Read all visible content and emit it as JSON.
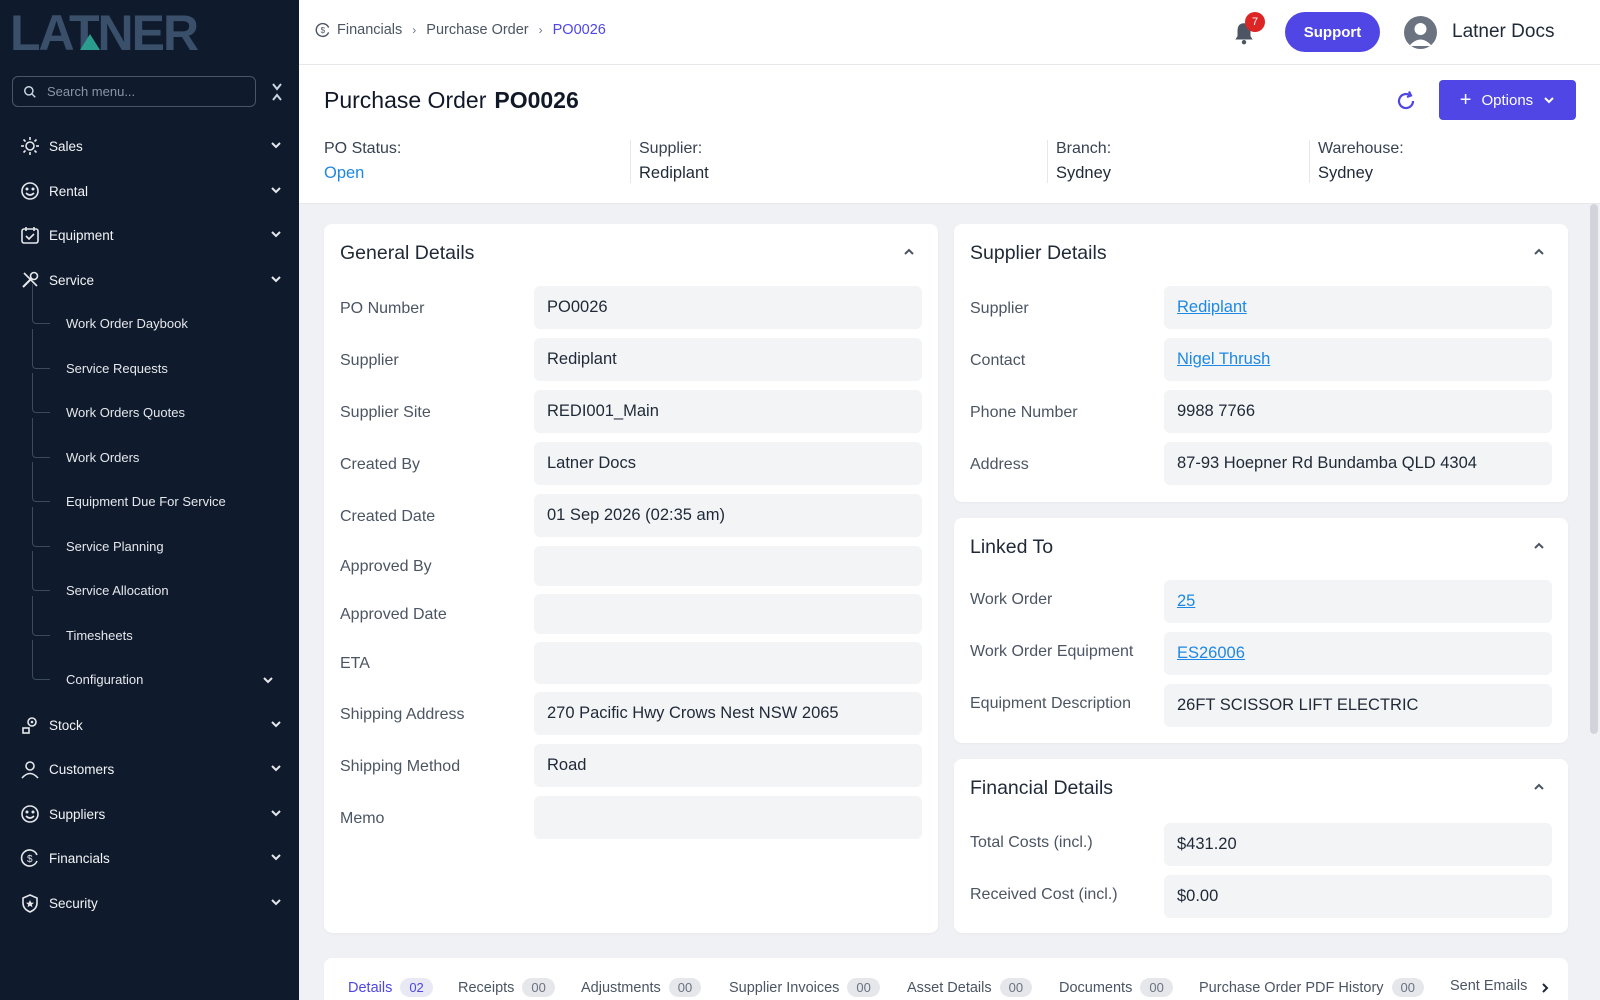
{
  "brand": {
    "logo_text": "LATNER"
  },
  "search": {
    "placeholder": "Search menu..."
  },
  "sidebar": {
    "items": [
      {
        "label": "Sales",
        "icon": "sales-icon"
      },
      {
        "label": "Rental",
        "icon": "rental-icon"
      },
      {
        "label": "Equipment",
        "icon": "equipment-icon"
      },
      {
        "label": "Service",
        "icon": "service-icon"
      },
      {
        "label": "Stock",
        "icon": "stock-icon"
      },
      {
        "label": "Customers",
        "icon": "customers-icon"
      },
      {
        "label": "Suppliers",
        "icon": "suppliers-icon"
      },
      {
        "label": "Financials",
        "icon": "financials-icon"
      },
      {
        "label": "Security",
        "icon": "security-icon"
      }
    ],
    "service_sub": [
      "Work Order Daybook",
      "Service Requests",
      "Work Orders Quotes",
      "Work Orders",
      "Equipment Due For Service",
      "Service Planning",
      "Service Allocation",
      "Timesheets",
      "Configuration"
    ]
  },
  "topbar": {
    "breadcrumb": [
      "Financials",
      "Purchase Order",
      "PO0026"
    ],
    "notifications": "7",
    "support_label": "Support",
    "user_name": "Latner Docs"
  },
  "header": {
    "title_prefix": "Purchase Order",
    "title_id": "PO0026",
    "options_label": "Options",
    "stats": [
      {
        "label": "PO Status:",
        "value": "Open"
      },
      {
        "label": "Supplier:",
        "value": "Rediplant"
      },
      {
        "label": "Branch:",
        "value": "Sydney"
      },
      {
        "label": "Warehouse:",
        "value": "Sydney"
      }
    ]
  },
  "general": {
    "title": "General Details",
    "fields": [
      {
        "label": "PO Number",
        "value": "PO0026"
      },
      {
        "label": "Supplier",
        "value": "Rediplant"
      },
      {
        "label": "Supplier Site",
        "value": "REDI001_Main"
      },
      {
        "label": "Created By",
        "value": "Latner Docs"
      },
      {
        "label": "Created Date",
        "value": "01 Sep 2026 (02:35 am)"
      },
      {
        "label": "Approved By",
        "value": ""
      },
      {
        "label": "Approved Date",
        "value": ""
      },
      {
        "label": "ETA",
        "value": ""
      },
      {
        "label": "Shipping Address",
        "value": "270 Pacific Hwy Crows Nest NSW 2065"
      },
      {
        "label": "Shipping Method",
        "value": "Road"
      },
      {
        "label": "Memo",
        "value": ""
      }
    ]
  },
  "supplier": {
    "title": "Supplier Details",
    "fields": [
      {
        "label": "Supplier",
        "value": "Rediplant"
      },
      {
        "label": "Contact",
        "value": "Nigel Thrush"
      },
      {
        "label": "Phone Number",
        "value": "9988 7766"
      },
      {
        "label": "Address",
        "value": "87-93 Hoepner Rd Bundamba QLD 4304"
      }
    ]
  },
  "linked": {
    "title": "Linked To",
    "fields": [
      {
        "label": "Work Order",
        "value": "25"
      },
      {
        "label": "Work Order Equipment",
        "value": "ES26006"
      },
      {
        "label": "Equipment Description",
        "value": "26FT SCISSOR LIFT ELECTRIC"
      }
    ]
  },
  "financial": {
    "title": "Financial Details",
    "fields": [
      {
        "label": "Total Costs (incl.)",
        "value": "$431.20"
      },
      {
        "label": "Received Cost (incl.)",
        "value": "$0.00"
      }
    ]
  },
  "tabs": [
    {
      "label": "Details",
      "count": "02"
    },
    {
      "label": "Receipts",
      "count": "00"
    },
    {
      "label": "Adjustments",
      "count": "00"
    },
    {
      "label": "Supplier Invoices",
      "count": "00"
    },
    {
      "label": "Asset Details",
      "count": "00"
    },
    {
      "label": "Documents",
      "count": "00"
    },
    {
      "label": "Purchase Order PDF History",
      "count": "00"
    },
    {
      "label": "Sent Emails",
      "count": ""
    }
  ],
  "colors": {
    "sidebar_bg": "#0f1b2d",
    "accent": "#4f46e5",
    "link": "#1e88e5",
    "logo": "#2a9d8f"
  }
}
